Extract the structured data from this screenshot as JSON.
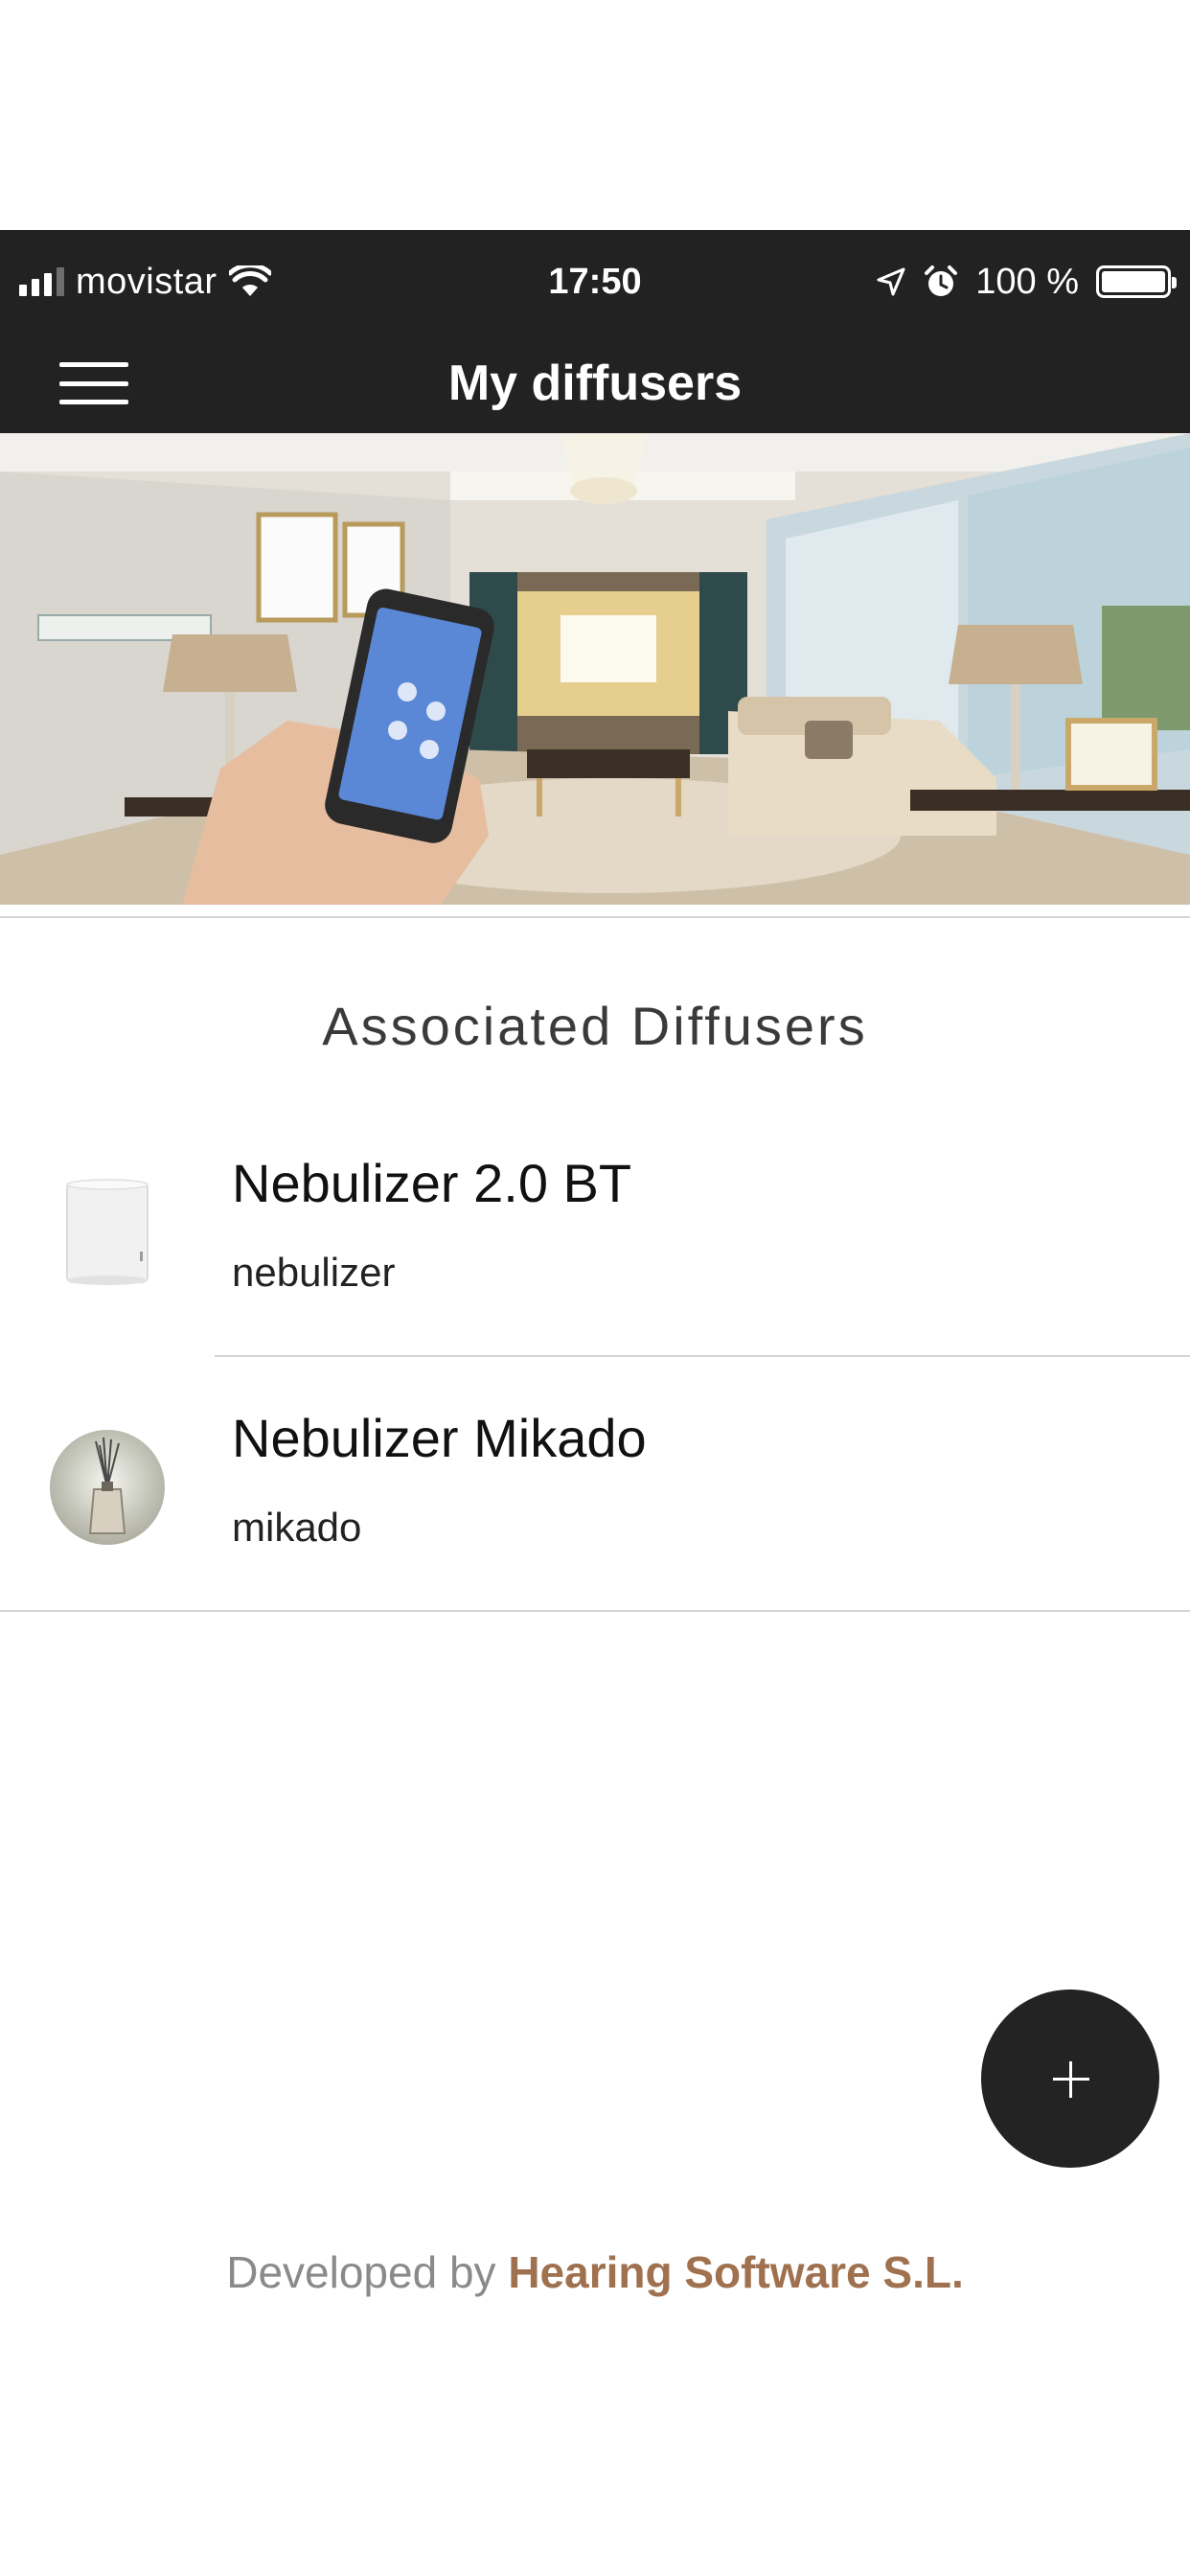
{
  "status_bar": {
    "carrier": "movistar",
    "time": "17:50",
    "battery_percent": "100 %",
    "battery_level": 1.0,
    "icons": [
      "signal-icon",
      "wifi-icon",
      "location-icon",
      "alarm-icon",
      "battery-icon"
    ]
  },
  "nav": {
    "title": "My diffusers",
    "menu_icon": "hamburger-menu-icon"
  },
  "hero": {
    "image": "living-room-smartphone-photo"
  },
  "section": {
    "title": "Associated Diffusers"
  },
  "diffusers": [
    {
      "name": "Nebulizer 2.0 BT",
      "type": "nebulizer",
      "thumbnail": "white-nebulizer-thumbnail"
    },
    {
      "name": "Nebulizer Mikado",
      "type": "mikado",
      "thumbnail": "mikado-reed-diffuser-thumbnail"
    }
  ],
  "fab": {
    "icon": "plus-icon"
  },
  "footer": {
    "prefix": "Developed by ",
    "company": "Hearing Software S.L."
  },
  "colors": {
    "bar_background": "#222222",
    "fab_background": "#232323",
    "brand_accent": "#a0714f",
    "divider": "#d4d4d4"
  }
}
